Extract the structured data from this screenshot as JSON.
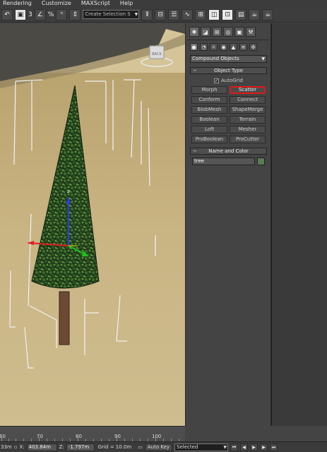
{
  "menu": [
    "Rendering",
    "Customize",
    "MAXScript",
    "Help"
  ],
  "toolbar": {
    "selection_set_placeholder": "Create Selection S",
    "icons": [
      "undo-icon",
      "image-save-icon",
      "snap-3d-icon",
      "percent-snap-icon",
      "spinner-snap-icon",
      "selection-set-dropdown",
      "mirror-icon",
      "align-icon",
      "layer-icon",
      "curve-editor-icon",
      "schematic-icon",
      "material-editor-icon",
      "render-setup-icon",
      "rendered-frame-icon",
      "render-icon",
      "teapot-render-icon"
    ],
    "snap_label": "3",
    "percent_label": "%",
    "spinner_label": "n"
  },
  "viewport": {
    "viewcube_label": "BACK",
    "gizmo_z_label": "z"
  },
  "command_panel": {
    "main_tabs": [
      "create-tab",
      "modify-tab",
      "hierarchy-tab",
      "motion-tab",
      "display-tab",
      "utilities-tab"
    ],
    "sub_tabs": [
      "geometry-tab",
      "shapes-tab",
      "lights-tab",
      "cameras-tab",
      "helpers-tab",
      "spacewarps-tab",
      "systems-tab"
    ],
    "category": "Compound Objects",
    "object_type": {
      "title": "Object Type",
      "autogrid_label": "AutoGrid",
      "autogrid_checked": true,
      "buttons": [
        "Morph",
        "Scatter",
        "Conform",
        "Connect",
        "BlobMesh",
        "ShapeMerge",
        "Boolean",
        "Terrain",
        "Loft",
        "Mesher",
        "ProBoolean",
        "ProCutter"
      ],
      "highlighted": "Scatter"
    },
    "name_color": {
      "title": "Name and Color",
      "name_value": "tree",
      "color": "#5e7a55"
    }
  },
  "timeline": {
    "ticks": [
      "60",
      "70",
      "80",
      "90",
      "100"
    ]
  },
  "status": {
    "left_cut": "33m",
    "x_label": "X:",
    "x_value": "403.84m",
    "z_label": "Z:",
    "z_value": "-1.797m",
    "grid": "Grid = 10.0m",
    "autokey": "Auto Key",
    "selected": "Selected"
  }
}
